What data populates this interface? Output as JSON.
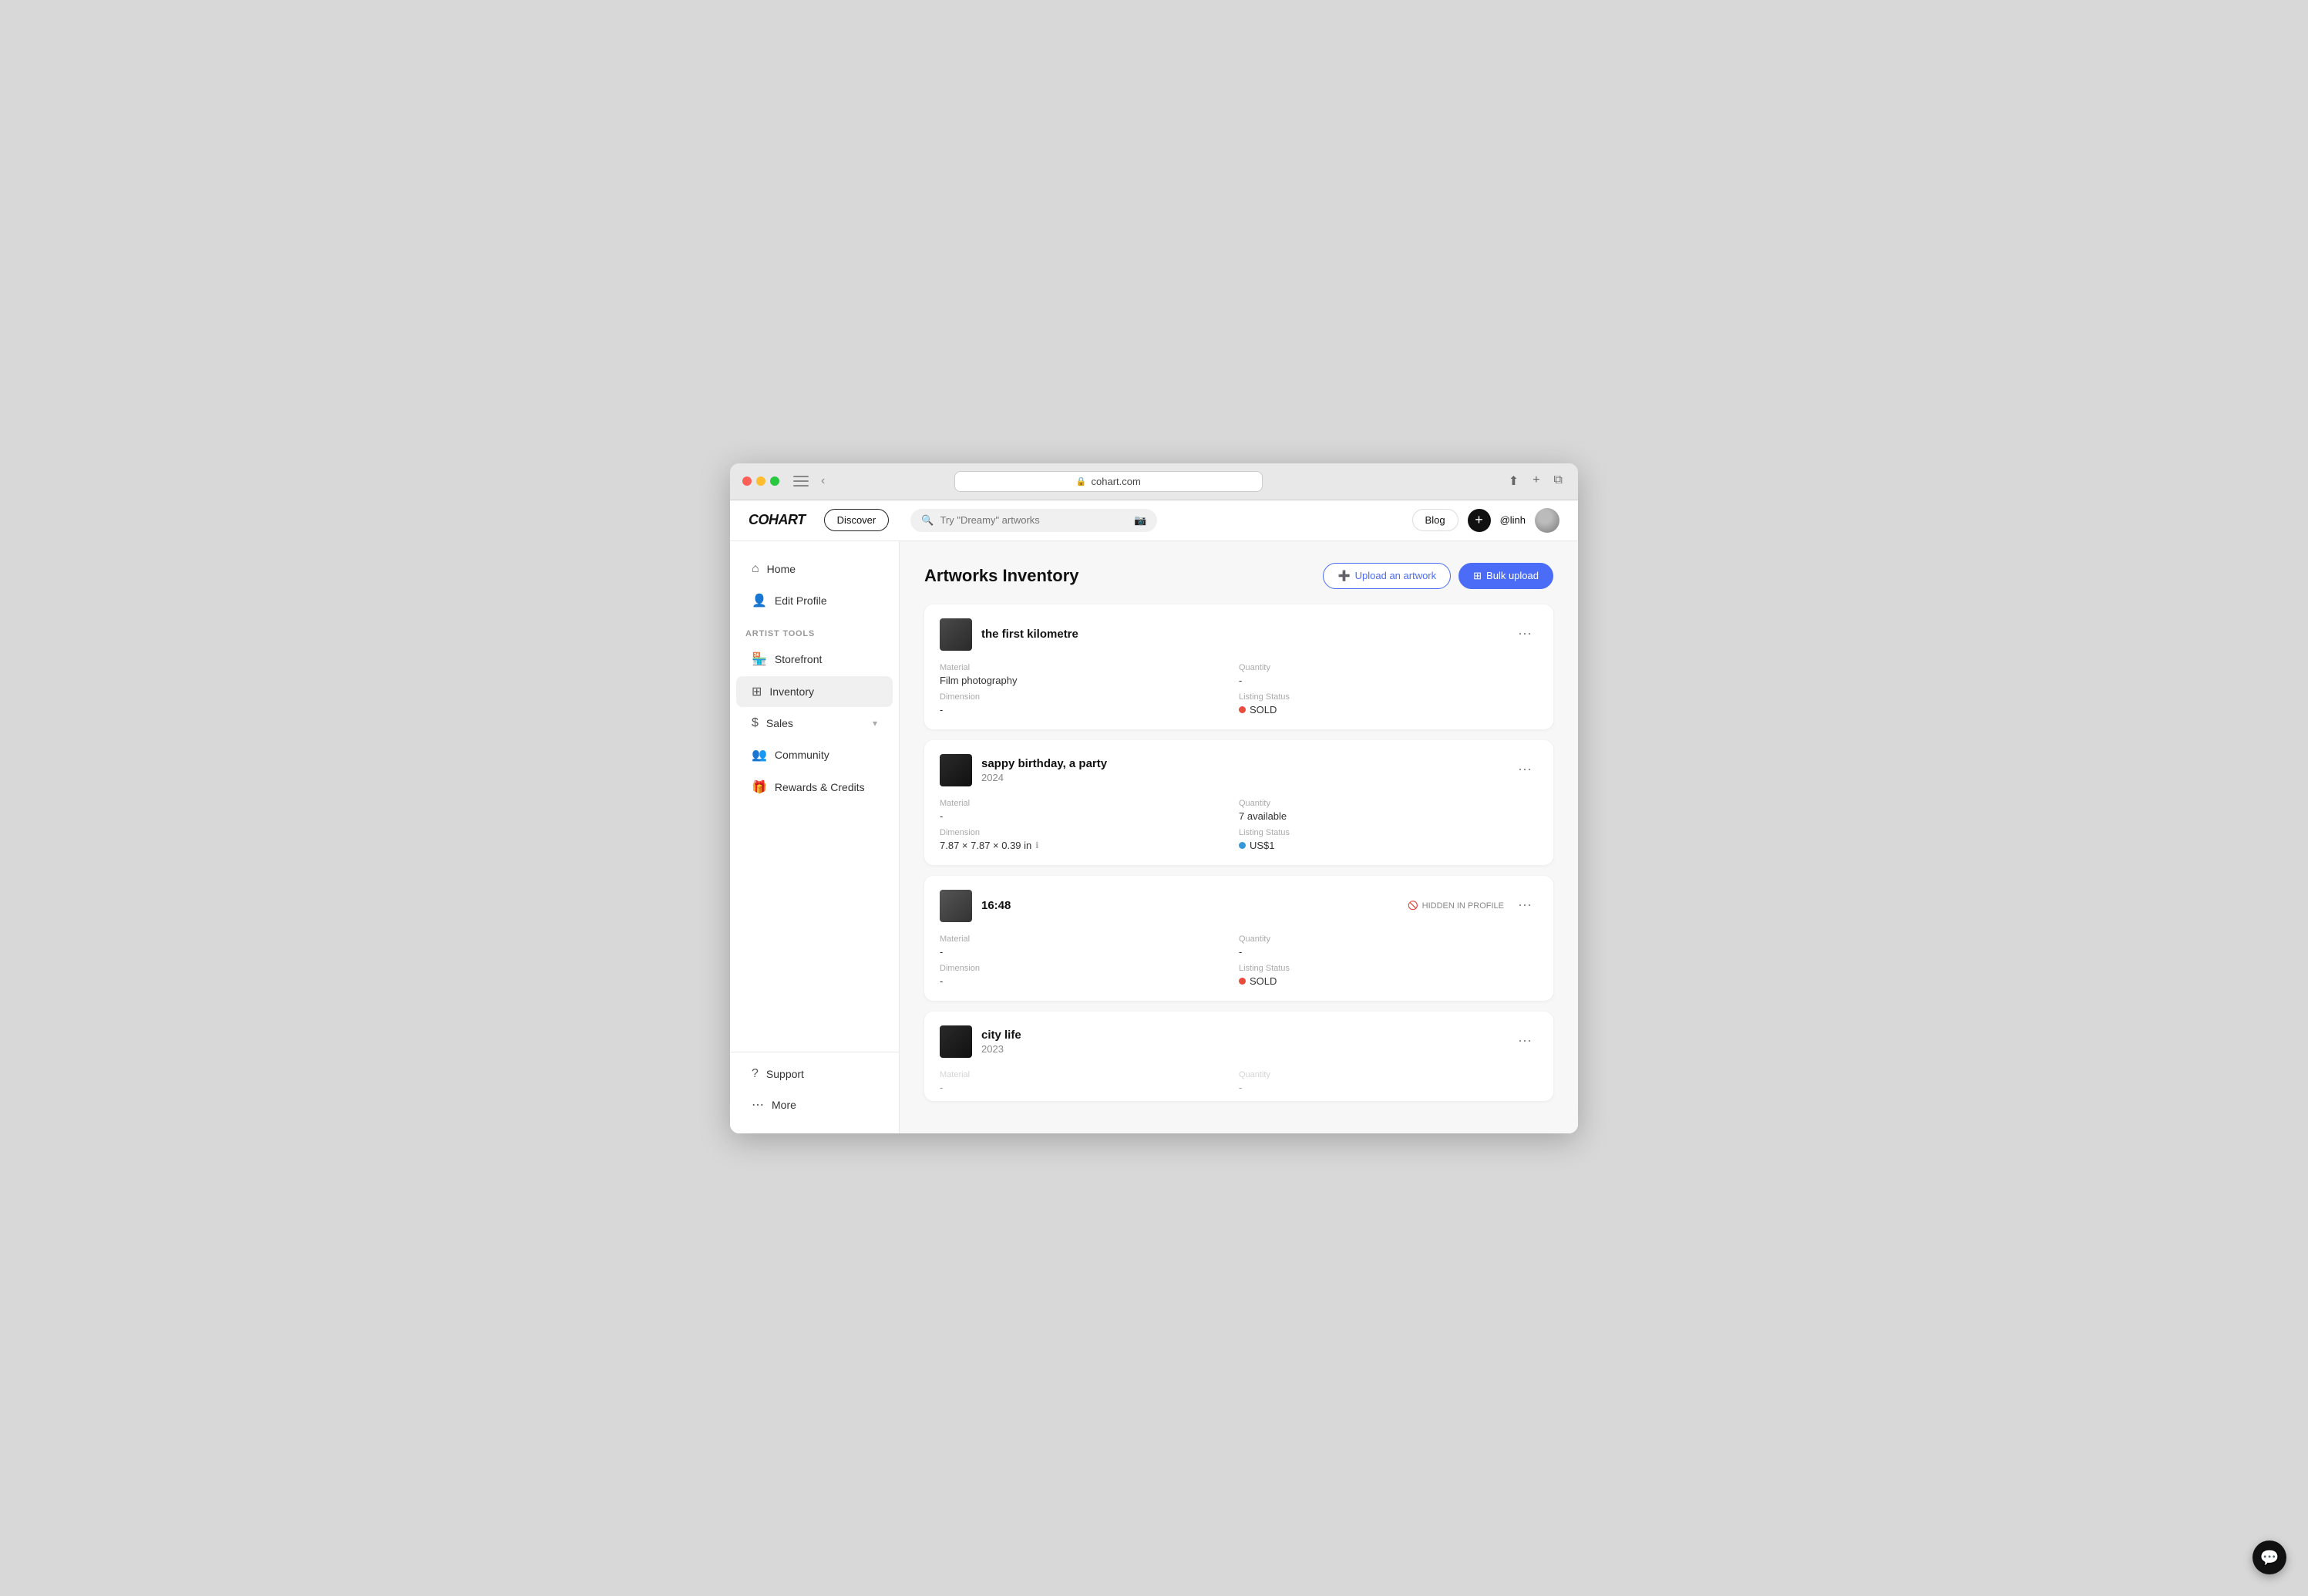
{
  "browser": {
    "url": "cohart.com",
    "url_icon": "🔒"
  },
  "nav": {
    "logo": "COHART",
    "discover_label": "Discover",
    "search_placeholder": "Try \"Dreamy\" artworks",
    "blog_label": "Blog",
    "plus_label": "+",
    "username": "@linh"
  },
  "sidebar": {
    "home_label": "Home",
    "edit_profile_label": "Edit Profile",
    "artist_tools_label": "ARTIST TOOLS",
    "storefront_label": "Storefront",
    "inventory_label": "Inventory",
    "sales_label": "Sales",
    "community_label": "Community",
    "rewards_label": "Rewards & Credits",
    "support_label": "Support",
    "more_label": "More"
  },
  "content": {
    "page_title": "Artworks Inventory",
    "upload_btn": "Upload an artwork",
    "bulk_btn": "Bulk upload",
    "artworks": [
      {
        "id": "1",
        "title": "the first kilometre",
        "year": "",
        "thumb_color": "#444",
        "material": "Film photography",
        "dimension": "-",
        "quantity": "-",
        "listing_status": "SOLD",
        "status_type": "sold",
        "hidden": false
      },
      {
        "id": "2",
        "title": "sappy birthday, a party",
        "year": "2024",
        "thumb_color": "#222",
        "material": "-",
        "dimension": "7.87 × 7.87 × 0.39 in",
        "quantity": "7 available",
        "listing_status": "US$1",
        "status_type": "listed",
        "hidden": false
      },
      {
        "id": "3",
        "title": "16:48",
        "year": "",
        "thumb_color": "#333",
        "material": "-",
        "dimension": "-",
        "quantity": "-",
        "listing_status": "SOLD",
        "status_type": "sold",
        "hidden": true,
        "hidden_label": "HIDDEN IN PROFILE"
      },
      {
        "id": "4",
        "title": "city life",
        "year": "2023",
        "thumb_color": "#222",
        "material": "-",
        "dimension": "",
        "quantity": "-",
        "listing_status": "",
        "status_type": "",
        "hidden": false
      }
    ]
  },
  "labels": {
    "material": "Material",
    "dimension": "Dimension",
    "quantity": "Quantity",
    "listing_status": "Listing Status"
  }
}
